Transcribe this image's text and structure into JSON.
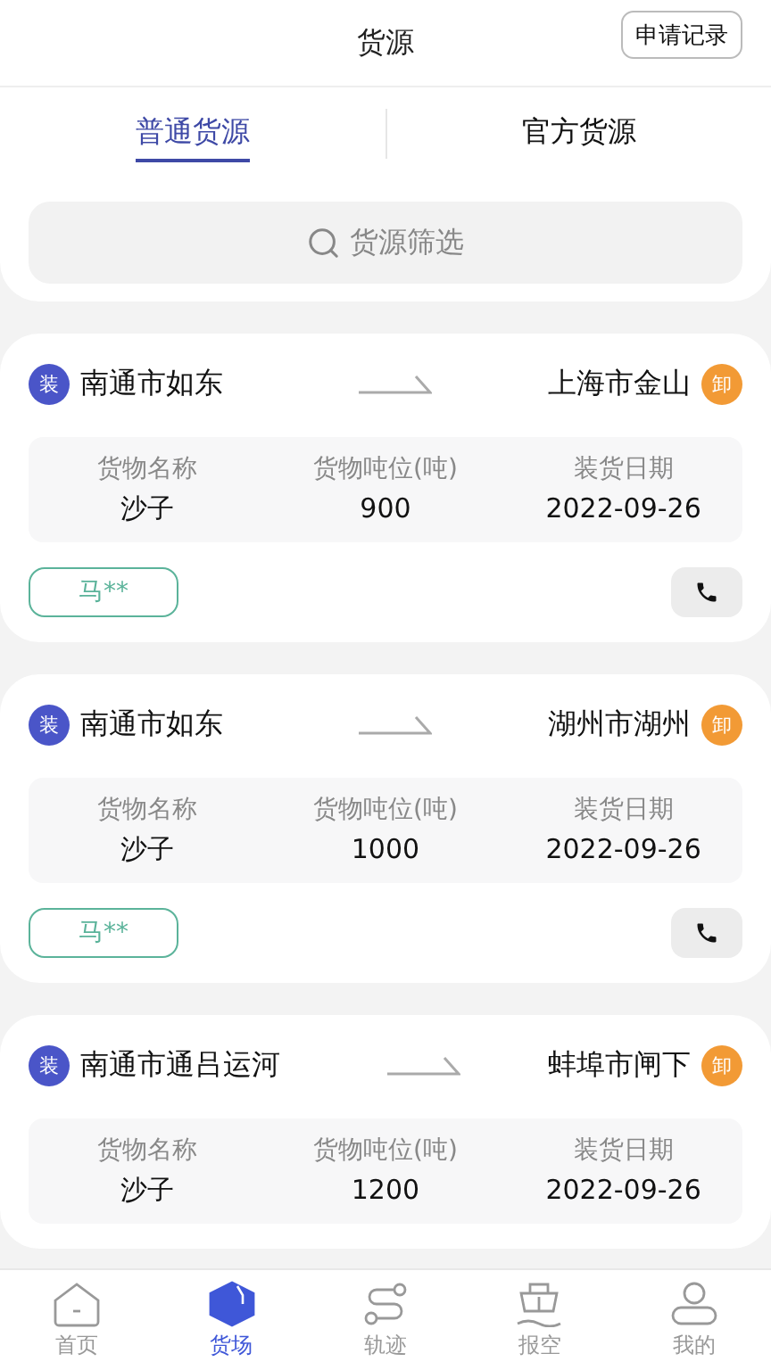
{
  "header": {
    "title": "货源",
    "action": "申请记录"
  },
  "tabs": [
    {
      "label": "普通货源",
      "selected": true
    },
    {
      "label": "官方货源",
      "selected": false
    }
  ],
  "search": {
    "placeholder": "货源筛选"
  },
  "cargo": [
    {
      "load_badge": "装",
      "origin": "南通市如东",
      "destination": "上海市金山",
      "unload_badge": "卸",
      "fields": [
        {
          "label": "货物名称",
          "value": "沙子"
        },
        {
          "label": "货物吨位(吨)",
          "value": "900"
        },
        {
          "label": "装货日期",
          "value": "2022-09-26"
        }
      ],
      "contact": "马**"
    },
    {
      "load_badge": "装",
      "origin": "南通市如东",
      "destination": "湖州市湖州",
      "unload_badge": "卸",
      "fields": [
        {
          "label": "货物名称",
          "value": "沙子"
        },
        {
          "label": "货物吨位(吨)",
          "value": "1000"
        },
        {
          "label": "装货日期",
          "value": "2022-09-26"
        }
      ],
      "contact": "马**"
    },
    {
      "load_badge": "装",
      "origin": "南通市通吕运河",
      "destination": "蚌埠市闸下",
      "unload_badge": "卸",
      "fields": [
        {
          "label": "货物名称",
          "value": "沙子"
        },
        {
          "label": "货物吨位(吨)",
          "value": "1200"
        },
        {
          "label": "装货日期",
          "value": "2022-09-26"
        }
      ]
    }
  ],
  "nav": [
    {
      "label": "首页",
      "kind": "home",
      "selected": false
    },
    {
      "label": "货场",
      "kind": "cargo",
      "selected": true
    },
    {
      "label": "轨迹",
      "kind": "track",
      "selected": false
    },
    {
      "label": "报空",
      "kind": "ship",
      "selected": false
    },
    {
      "label": "我的",
      "kind": "user",
      "selected": false
    }
  ]
}
